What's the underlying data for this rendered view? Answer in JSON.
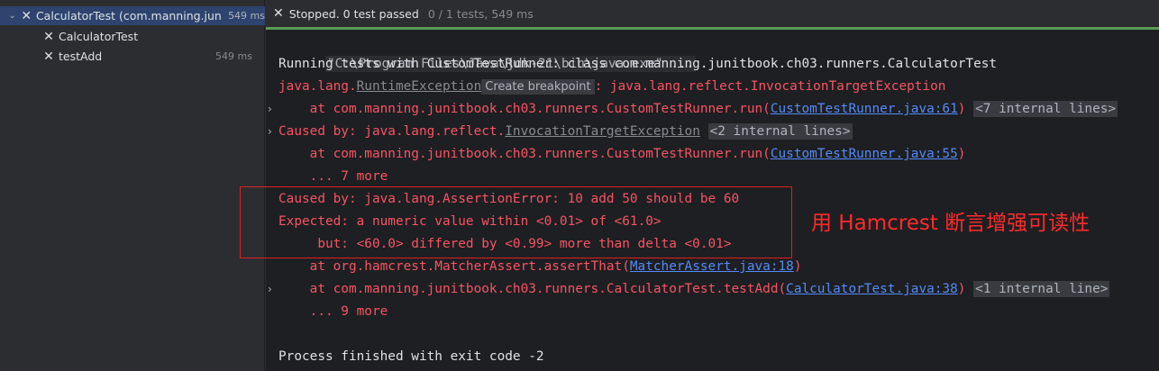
{
  "tree": {
    "root": {
      "name": "CalculatorTest (com.manning.junit",
      "time": "549 ms"
    },
    "children": [
      {
        "name": "CalculatorTest",
        "time": ""
      },
      {
        "name": "testAdd",
        "time": "549 ms"
      }
    ]
  },
  "status": {
    "text": "Stopped. 0 test passed",
    "count": "0 / 1 tests, 549 ms"
  },
  "console": {
    "cmd": "\"C:\\Program Files\\Java\\jdk-21\\bin\\java.exe\" ...",
    "running": "Running tests with CustomTestRunner: class com.manning.junitbook.ch03.runners.CalculatorTest",
    "l3_prefix": "java.lang.",
    "l3_exc": "RuntimeException",
    "l3_tooltip": "Create breakpoint",
    "l3_suffix": ": java.lang.reflect.InvocationTargetException",
    "l4_text": "    at com.manning.junitbook.ch03.runners.CustomTestRunner.run(",
    "l4_link": "CustomTestRunner.java:61",
    "l4_close": ")",
    "l4_fold": "<7 internal lines>",
    "l5_prefix": "Caused by: java.lang.reflect.",
    "l5_exc": "InvocationTargetException",
    "l5_fold": "<2 internal lines>",
    "l6_text": "    at com.manning.junitbook.ch03.runners.CustomTestRunner.run(",
    "l6_link": "CustomTestRunner.java:55",
    "l6_close": ")",
    "l7_text": "    ... 7 more",
    "l8_text": "Caused by: java.lang.AssertionError: 10 add 50 should be 60",
    "l9_text": "Expected: a numeric value within <0.01> of <61.0>",
    "l10_text": "     but: <60.0> differed by <0.99> more than delta <0.01>",
    "l11_text": "    at org.hamcrest.MatcherAssert.assertThat(",
    "l11_link": "MatcherAssert.java:18",
    "l11_close": ")",
    "l12_text": "    at com.manning.junitbook.ch03.runners.CalculatorTest.testAdd(",
    "l12_link": "CalculatorTest.java:38",
    "l12_close": ")",
    "l12_fold": "<1 internal line>",
    "l13_text": "    ... 9 more",
    "l15_text": "Process finished with exit code -2"
  },
  "annotation": "用 Hamcrest 断言增强可读性",
  "colors": {
    "error": "#f75464",
    "link": "#548af7",
    "annotation": "#ff2a2a",
    "progress": "#5a9b57"
  }
}
